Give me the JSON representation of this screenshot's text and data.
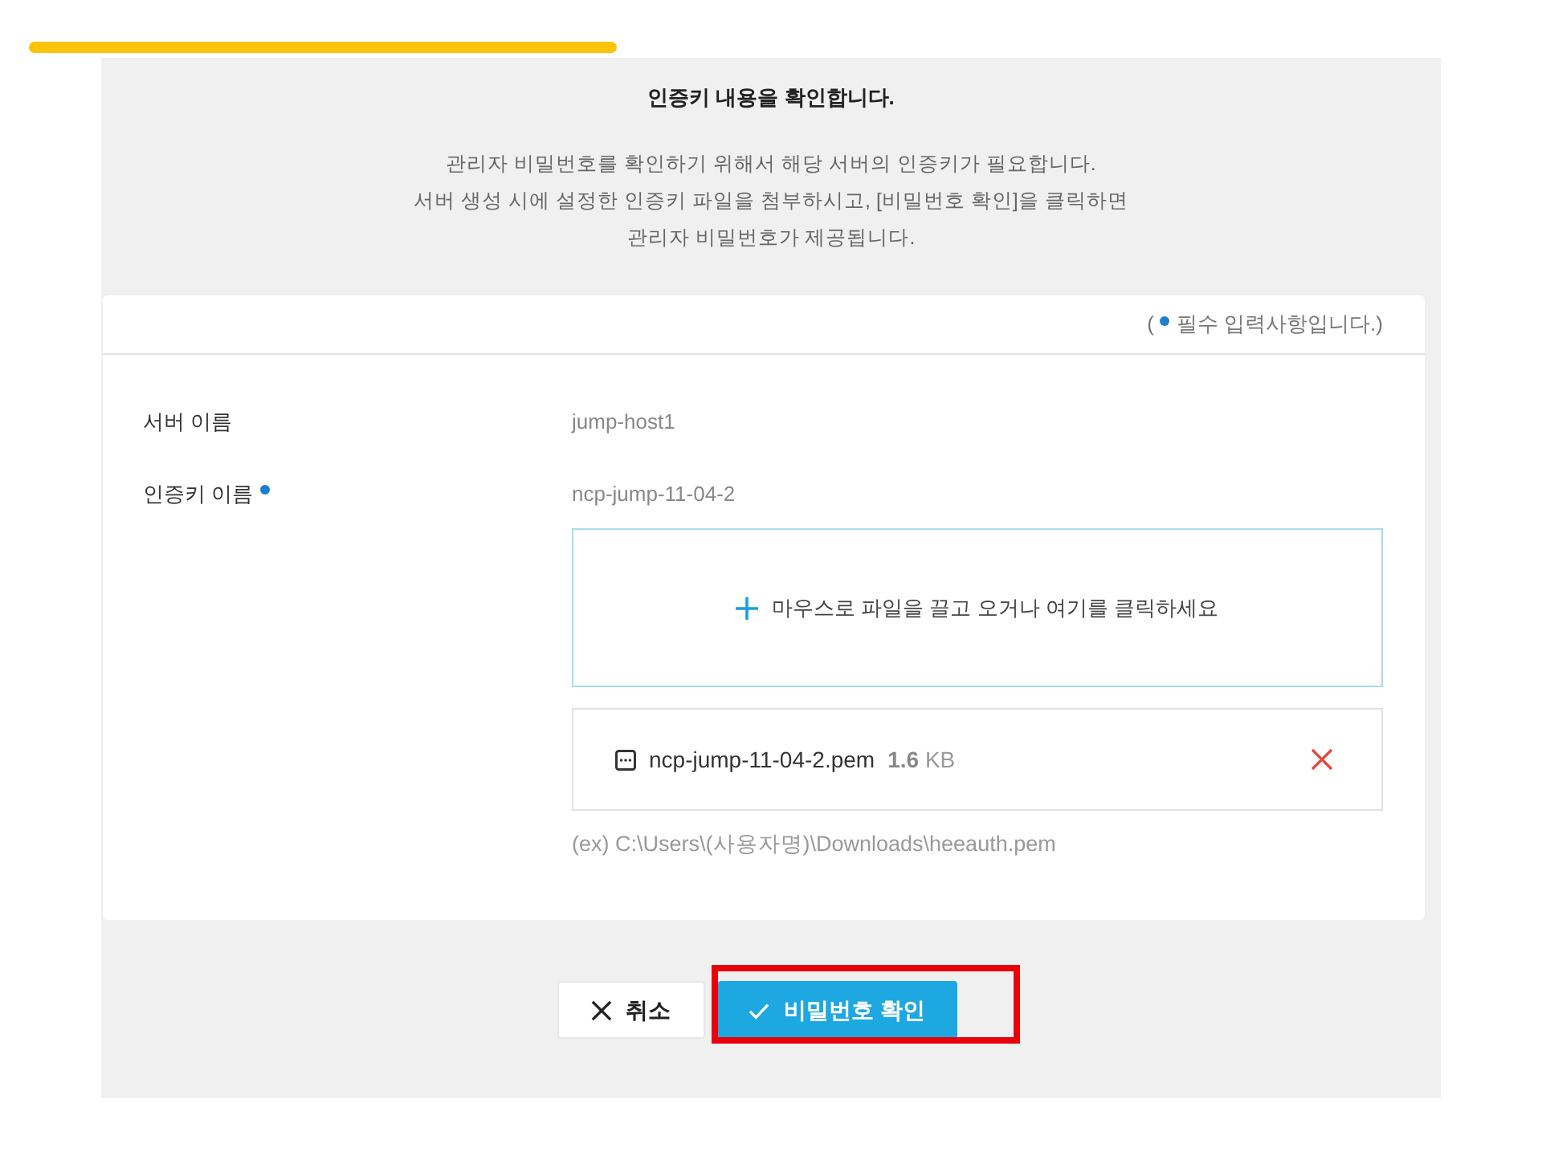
{
  "heading": "인증키 내용을 확인합니다.",
  "description": [
    "관리자 비밀번호를 확인하기 위해서 해당 서버의 인증키가 필요합니다.",
    "서버 생성 시에 설정한 인증키 파일을 첨부하시고, [비밀번호 확인]을 클릭하면",
    "관리자 비밀번호가 제공됩니다."
  ],
  "required_note": {
    "prefix": "(",
    "text": "필수 입력사항입니다.)"
  },
  "fields": [
    {
      "kind": "text",
      "label": "서버 이름",
      "value": "jump-host1",
      "required": false
    },
    {
      "kind": "upload",
      "label": "인증키 이름",
      "value": "ncp-jump-11-04-2",
      "required": true,
      "dropzone": "마우스로 파일을 끌고 오거나 여기를 클릭하세요",
      "file": {
        "name": "ncp-jump-11-04-2.pem",
        "size": "**1.6** KB"
      },
      "hint": "(ex) C:\\Users\\(사용자명)\\Downloads\\heeauth.pem"
    }
  ],
  "buttons": [
    {
      "kind": "cancel",
      "label": "취소",
      "highlighted": false
    },
    {
      "kind": "confirm",
      "label": "비밀번호 확인",
      "highlighted": true
    }
  ]
}
